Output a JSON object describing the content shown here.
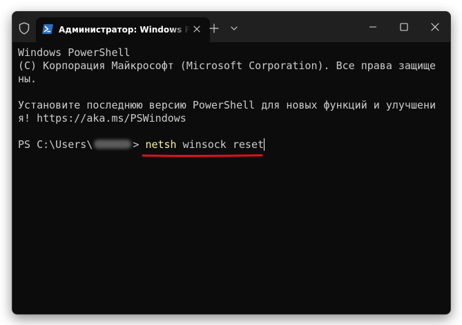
{
  "window": {
    "tab_title": "Администратор: Windows PowerShell"
  },
  "terminal": {
    "lines": [
      "Windows PowerShell",
      "(C) Корпорация Майкрософт (Microsoft Corporation). Все права защище",
      "ны.",
      "",
      "Установите последнюю версию PowerShell для новых функций и улучшени",
      "я! https://aka.ms/PSWindows"
    ],
    "prompt_prefix": "PS C:\\Users\\",
    "prompt_suffix": ">",
    "command_keyword": "netsh",
    "command_args": "winsock reset"
  },
  "colors": {
    "terminal_bg": "#0c0c0c",
    "titlebar_bg": "#202020",
    "text": "#cccccc",
    "command_highlight": "#f9f1a5",
    "annotation_underline": "#e0101c"
  },
  "icons": {
    "shield": "shield-icon",
    "tab": "powershell-icon",
    "tab_close": "close-icon",
    "new_tab": "plus-icon",
    "dropdown": "chevron-down-icon",
    "minimize": "minimize-icon",
    "maximize": "maximize-icon",
    "close": "close-icon"
  }
}
